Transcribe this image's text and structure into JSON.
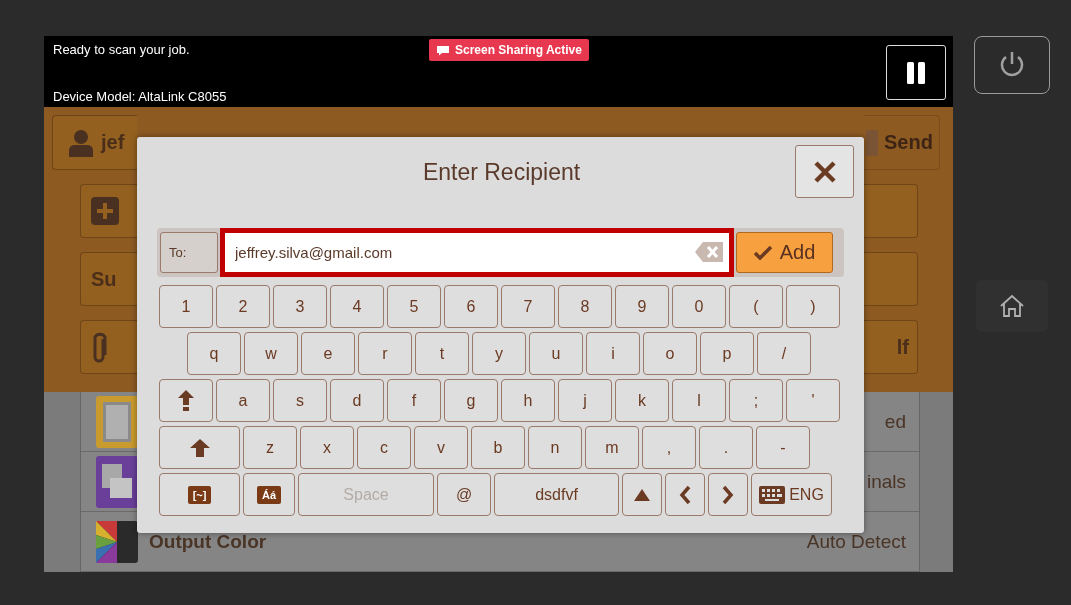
{
  "status_bar": {
    "message": "Ready to scan your job.",
    "device_model": "Device Model: AltaLink C8055",
    "sharing_badge": "Screen Sharing Active"
  },
  "background": {
    "user_button": "jef",
    "send_button": "Send",
    "left_buttons": [
      {
        "kind": "add"
      },
      {
        "kind": "text",
        "label": "Su"
      },
      {
        "kind": "attach"
      }
    ],
    "right_buttons": [
      {
        "kind": "blank"
      },
      {
        "kind": "blank"
      },
      {
        "kind": "text",
        "label": "lf"
      }
    ],
    "feature_rows": [
      {
        "kind": "layout",
        "value": "ed"
      },
      {
        "kind": "overlay",
        "value": "inals"
      },
      {
        "kind": "color",
        "label": "Output Color",
        "value": "Auto Detect"
      }
    ]
  },
  "dialog": {
    "title": "Enter Recipient",
    "to_label": "To:",
    "value": "jeffrey.silva@gmail.com",
    "add_button": "Add"
  },
  "keyboard": {
    "rows": [
      {
        "keys": [
          {
            "kind": "char",
            "label": "1"
          },
          {
            "kind": "char",
            "label": "2"
          },
          {
            "kind": "char",
            "label": "3"
          },
          {
            "kind": "char",
            "label": "4"
          },
          {
            "kind": "char",
            "label": "5"
          },
          {
            "kind": "char",
            "label": "6"
          },
          {
            "kind": "char",
            "label": "7"
          },
          {
            "kind": "char",
            "label": "8"
          },
          {
            "kind": "char",
            "label": "9"
          },
          {
            "kind": "char",
            "label": "0"
          },
          {
            "kind": "char",
            "label": "("
          },
          {
            "kind": "char",
            "label": ")"
          }
        ]
      },
      {
        "keys": [
          {
            "kind": "char",
            "label": "q"
          },
          {
            "kind": "char",
            "label": "w"
          },
          {
            "kind": "char",
            "label": "e"
          },
          {
            "kind": "char",
            "label": "r"
          },
          {
            "kind": "char",
            "label": "t"
          },
          {
            "kind": "char",
            "label": "y"
          },
          {
            "kind": "char",
            "label": "u"
          },
          {
            "kind": "char",
            "label": "i"
          },
          {
            "kind": "char",
            "label": "o"
          },
          {
            "kind": "char",
            "label": "p"
          },
          {
            "kind": "char",
            "label": "/"
          }
        ]
      },
      {
        "keys": [
          {
            "kind": "caps"
          },
          {
            "kind": "char",
            "label": "a"
          },
          {
            "kind": "char",
            "label": "s"
          },
          {
            "kind": "char",
            "label": "d"
          },
          {
            "kind": "char",
            "label": "f"
          },
          {
            "kind": "char",
            "label": "g"
          },
          {
            "kind": "char",
            "label": "h"
          },
          {
            "kind": "char",
            "label": "j"
          },
          {
            "kind": "char",
            "label": "k"
          },
          {
            "kind": "char",
            "label": "l"
          },
          {
            "kind": "char",
            "label": ";"
          },
          {
            "kind": "char",
            "label": "'"
          }
        ]
      },
      {
        "keys": [
          {
            "kind": "shift"
          },
          {
            "kind": "char",
            "label": "z"
          },
          {
            "kind": "char",
            "label": "x"
          },
          {
            "kind": "char",
            "label": "c"
          },
          {
            "kind": "char",
            "label": "v"
          },
          {
            "kind": "char",
            "label": "b"
          },
          {
            "kind": "char",
            "label": "n"
          },
          {
            "kind": "char",
            "label": "m"
          },
          {
            "kind": "char",
            "label": ","
          },
          {
            "kind": "char",
            "label": "."
          },
          {
            "kind": "char",
            "label": "-"
          }
        ]
      },
      {
        "keys": [
          {
            "kind": "symbols",
            "label": "[~]"
          },
          {
            "kind": "accents",
            "label": "Áá"
          },
          {
            "kind": "space",
            "label": "Space",
            "disabled": true
          },
          {
            "kind": "char",
            "label": "@"
          },
          {
            "kind": "suggestion",
            "label": "dsdfvf"
          },
          {
            "kind": "up"
          },
          {
            "kind": "left"
          },
          {
            "kind": "right"
          },
          {
            "kind": "language",
            "label": "ENG"
          }
        ]
      }
    ]
  }
}
